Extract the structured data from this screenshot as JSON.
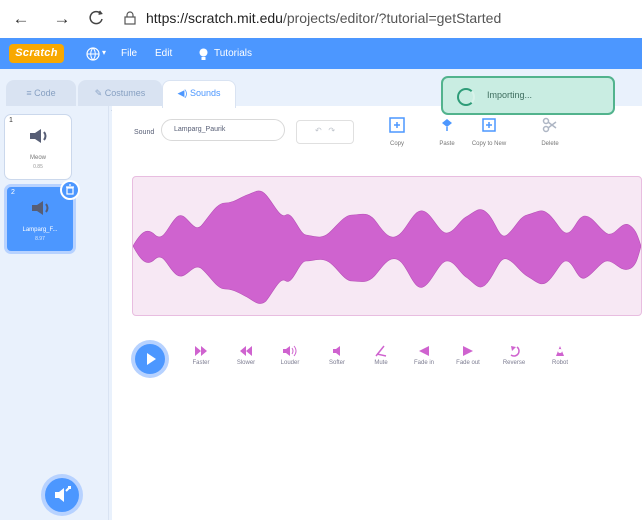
{
  "browser": {
    "back_icon": "arrow-left-icon",
    "forward_icon": "arrow-right-icon",
    "reload_icon": "reload-icon",
    "url_host": "https://scratch.mit.edu",
    "url_path": "/projects/editor/?tutorial=getStarted"
  },
  "menubar": {
    "logo": "Scratch",
    "file_label": "File",
    "edit_label": "Edit",
    "tutorials_label": "Tutorials"
  },
  "tabs": [
    {
      "label": "Code"
    },
    {
      "label": "Costumes"
    },
    {
      "label": "Sounds"
    }
  ],
  "sounds": [
    {
      "number": "1",
      "name": "Meow",
      "duration": "0.85"
    },
    {
      "number": "2",
      "name": "Lamparg_F...",
      "duration": "8.97"
    }
  ],
  "editor": {
    "sound_label": "Sound",
    "sound_name": "Lamparg_Paurik",
    "copy_label": "Copy",
    "paste_label": "Paste",
    "copy_new_label": "Copy to New",
    "delete_label": "Delete",
    "effects": [
      "Faster",
      "Slower",
      "Louder",
      "Softer",
      "Mute",
      "Fade in",
      "Fade out",
      "Reverse",
      "Robot"
    ]
  },
  "toast": {
    "text": "Importing..."
  },
  "colors": {
    "primary": "#4c97ff",
    "waveform": "#cf63cf",
    "toast_border": "#52b38d"
  }
}
